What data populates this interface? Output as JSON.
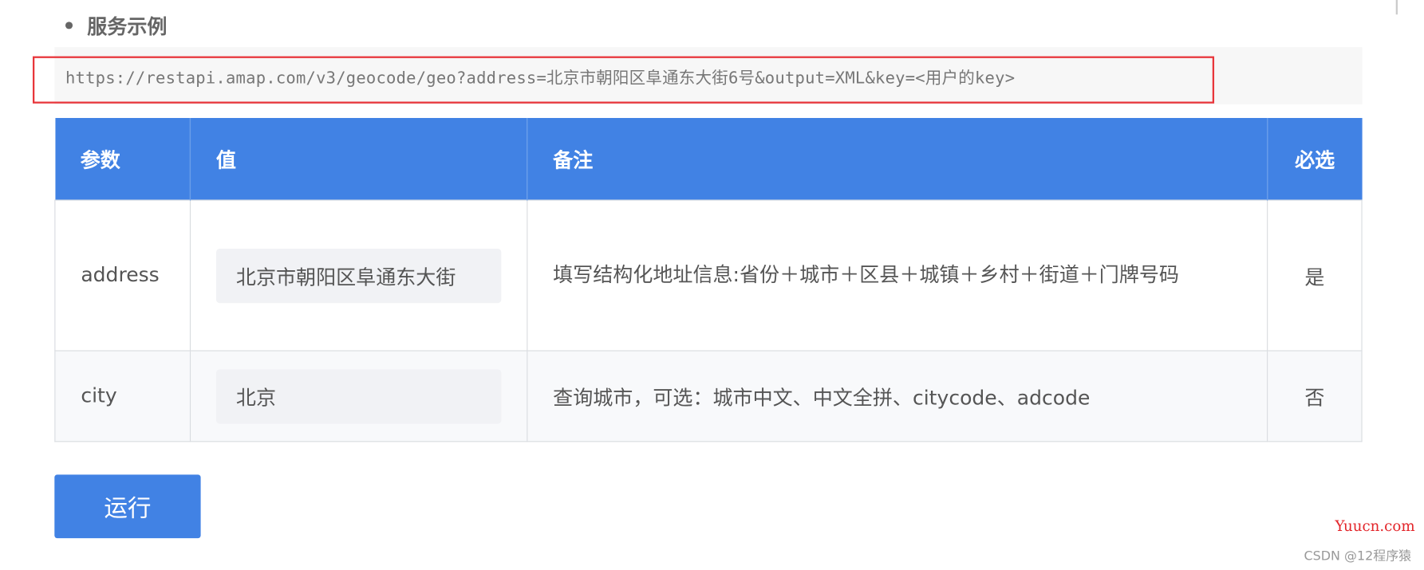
{
  "section": {
    "heading": "服务示例"
  },
  "example_url": "https://restapi.amap.com/v3/geocode/geo?address=北京市朝阳区阜通东大街6号&output=XML&key=<用户的key>",
  "table": {
    "headers": [
      "参数",
      "值",
      "备注",
      "必选"
    ],
    "rows": [
      {
        "param": "address",
        "value": "北京市朝阳区阜通东大街",
        "note": "填写结构化地址信息:省份＋城市＋区县＋城镇＋乡村＋街道＋门牌号码",
        "required": "是"
      },
      {
        "param": "city",
        "value": "北京",
        "note": "查询城市，可选：城市中文、中文全拼、citycode、adcode",
        "required": "否"
      }
    ]
  },
  "run_button": "运行",
  "watermarks": {
    "site": "Yuucn.com",
    "csdn": "CSDN @12程序猿"
  },
  "colors": {
    "header_bg": "#4182e4",
    "highlight_box": "#e8363b"
  }
}
